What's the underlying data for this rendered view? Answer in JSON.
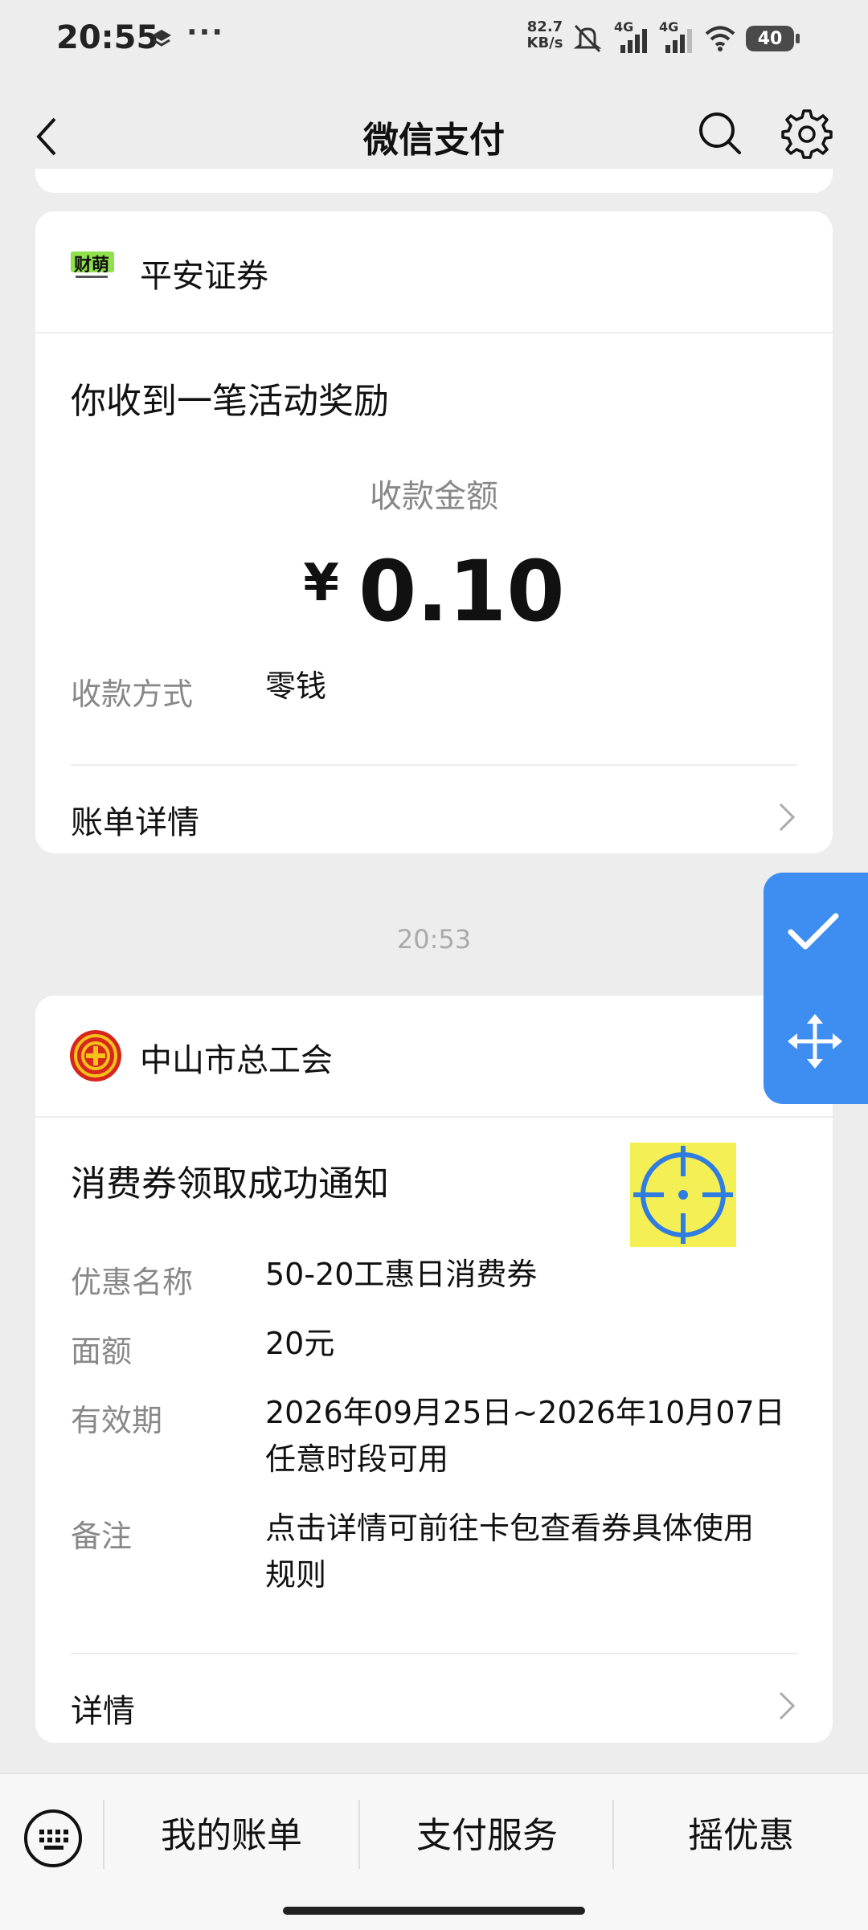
{
  "status_bar": {
    "time": "20:55",
    "net_speed_value": "82.7",
    "net_speed_unit": "KB/s",
    "signal1_label": "4G",
    "signal2_label": "4G",
    "battery": "40"
  },
  "nav": {
    "title": "微信支付",
    "back_icon": "chevron-left-icon",
    "search_icon": "search-icon",
    "settings_icon": "gear-icon"
  },
  "card1": {
    "brand_name": "平安证券",
    "logo_text": "财萌",
    "title": "你收到一笔活动奖励",
    "amount_label": "收款金额",
    "currency": "¥",
    "amount": "0.10",
    "method_label": "收款方式",
    "method_value": "零钱",
    "link_label": "账单详情"
  },
  "timestamp": "20:53",
  "card2": {
    "brand_name": "中山市总工会",
    "title": "消费券领取成功通知",
    "rows": [
      {
        "label": "优惠名称",
        "value": "50-20工惠日消费券"
      },
      {
        "label": "面额",
        "value": "20元"
      },
      {
        "label": "有效期",
        "value": "2026年09月25日~2026年10月07日",
        "value2": "任意时段可用"
      },
      {
        "label": "备注",
        "value": "点击详情可前往卡包查看券具体使用",
        "value2": "规则"
      }
    ],
    "link_label": "详情"
  },
  "bottom_bar": {
    "keyboard_icon": "keyboard-icon",
    "tabs": [
      "我的账单",
      "支付服务",
      "摇优惠"
    ]
  },
  "colors": {
    "float_widget": "#3d8ef0",
    "target_bg": "#f3ef55",
    "target_stroke": "#2f7de0"
  }
}
